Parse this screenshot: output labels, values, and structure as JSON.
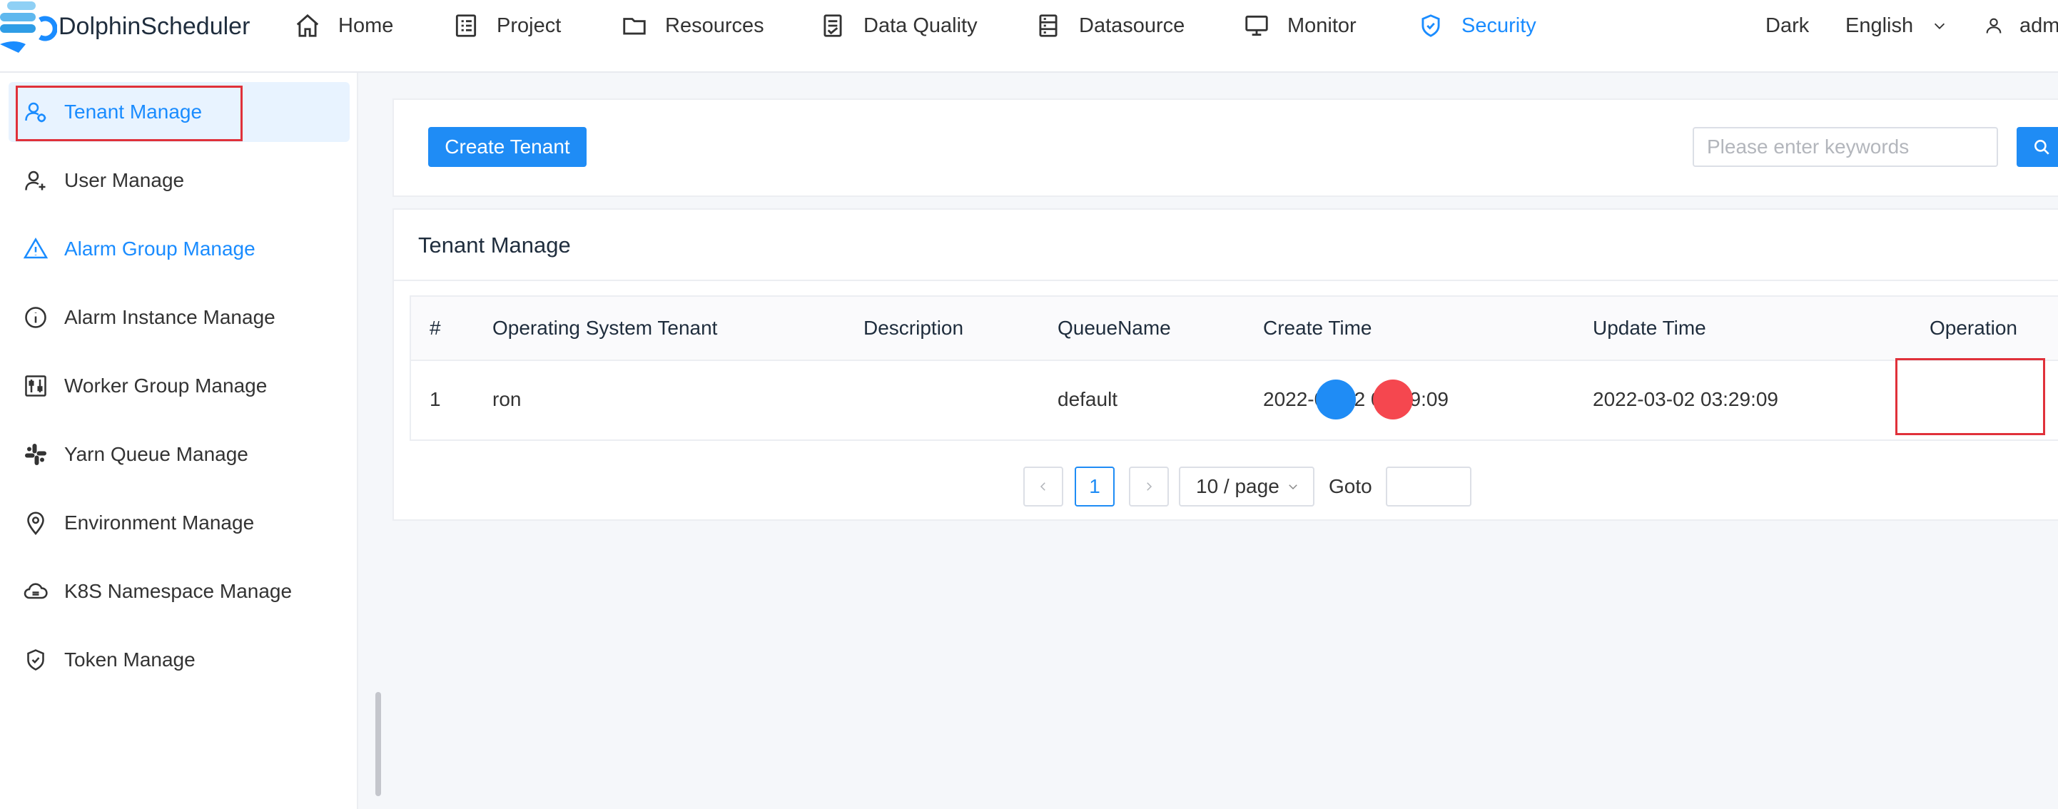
{
  "app": {
    "name": "DolphinScheduler"
  },
  "nav": {
    "items": [
      {
        "label": "Home",
        "icon": "home-icon"
      },
      {
        "label": "Project",
        "icon": "project-icon"
      },
      {
        "label": "Resources",
        "icon": "folder-icon"
      },
      {
        "label": "Data Quality",
        "icon": "data-quality-icon"
      },
      {
        "label": "Datasource",
        "icon": "datasource-icon"
      },
      {
        "label": "Monitor",
        "icon": "monitor-icon"
      },
      {
        "label": "Security",
        "icon": "shield-icon",
        "active": true
      }
    ],
    "theme_label": "Dark",
    "language_label": "English",
    "user_label": "adm"
  },
  "sidebar": {
    "items": [
      {
        "label": "Tenant Manage",
        "icon": "tenant-icon",
        "selected": true
      },
      {
        "label": "User Manage",
        "icon": "user-add-icon"
      },
      {
        "label": "Alarm Group Manage",
        "icon": "warning-icon"
      },
      {
        "label": "Alarm Instance Manage",
        "icon": "info-icon"
      },
      {
        "label": "Worker Group Manage",
        "icon": "sliders-icon"
      },
      {
        "label": "Yarn Queue Manage",
        "icon": "slack-icon"
      },
      {
        "label": "Environment Manage",
        "icon": "location-icon"
      },
      {
        "label": "K8S Namespace Manage",
        "icon": "cloud-icon"
      },
      {
        "label": "Token Manage",
        "icon": "shield-check-icon"
      }
    ]
  },
  "toolbar": {
    "create_label": "Create Tenant",
    "search_placeholder": "Please enter keywords"
  },
  "table": {
    "title": "Tenant Manage",
    "columns": [
      "#",
      "Operating System Tenant",
      "Description",
      "QueueName",
      "Create Time",
      "Update Time",
      "Operation"
    ],
    "rows": [
      {
        "index": "1",
        "tenant": "ron",
        "description": "",
        "queue": "default",
        "create_time": "2022-03-02 03:29:09",
        "update_time": "2022-03-02 03:29:09"
      }
    ]
  },
  "pagination": {
    "current_page": "1",
    "page_size_label": "10 / page",
    "goto_label": "Goto"
  },
  "colors": {
    "accent": "#1a8cff",
    "edit_button": "#1f8cf5",
    "delete_button": "#f5474f",
    "highlight_box": "#e0313a"
  }
}
